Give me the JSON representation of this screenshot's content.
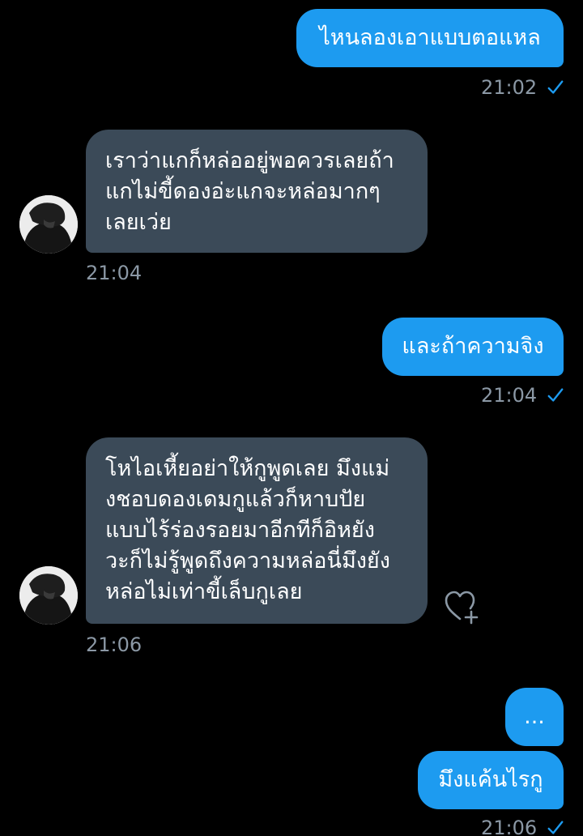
{
  "messages": [
    {
      "id": "m1",
      "direction": "outgoing",
      "text": "ไหนลองเอาแบบตอแหล",
      "time": "21:02",
      "read": true
    },
    {
      "id": "m2",
      "direction": "incoming",
      "lines": [
        "เราว่าแกก็หล่ออยู่พอควรเลยถ้า",
        "แกไม่ขี้ดองอ่ะแกจะหล่อมากๆ",
        "เลยเว่ย"
      ],
      "time": "21:04"
    },
    {
      "id": "m3",
      "direction": "outgoing",
      "text": "และถ้าความจิง",
      "time": "21:04",
      "read": true
    },
    {
      "id": "m4",
      "direction": "incoming",
      "lines": [
        "โหไอเหี้ยอย่าให้กูพูดเลย มึงแม่",
        "งชอบดองเดมกูแล้วก็หาบปัย",
        "แบบไร้ร่องรอยมาอีกทีก็อิหยัง",
        "วะก็ไม่รู้พูดถึงความหล่อนี่มึงยัง",
        "หล่อไม่เท่าขี้เล็บกูเลย"
      ],
      "time": "21:06"
    },
    {
      "id": "m5",
      "direction": "outgoing",
      "text": "...",
      "time": ""
    },
    {
      "id": "m6",
      "direction": "outgoing",
      "text": "มึงแค้นไรกู",
      "time": "21:06",
      "read": true
    }
  ],
  "colors": {
    "background": "#000000",
    "outgoing_bubble": "#1d9bf0",
    "incoming_bubble": "#3b4a58",
    "meta_text": "#8b98a5",
    "read_check": "#1d9bf0"
  },
  "icons": {
    "read_receipt": "check-icon",
    "react": "heart-plus-icon",
    "avatar": "user-avatar"
  }
}
